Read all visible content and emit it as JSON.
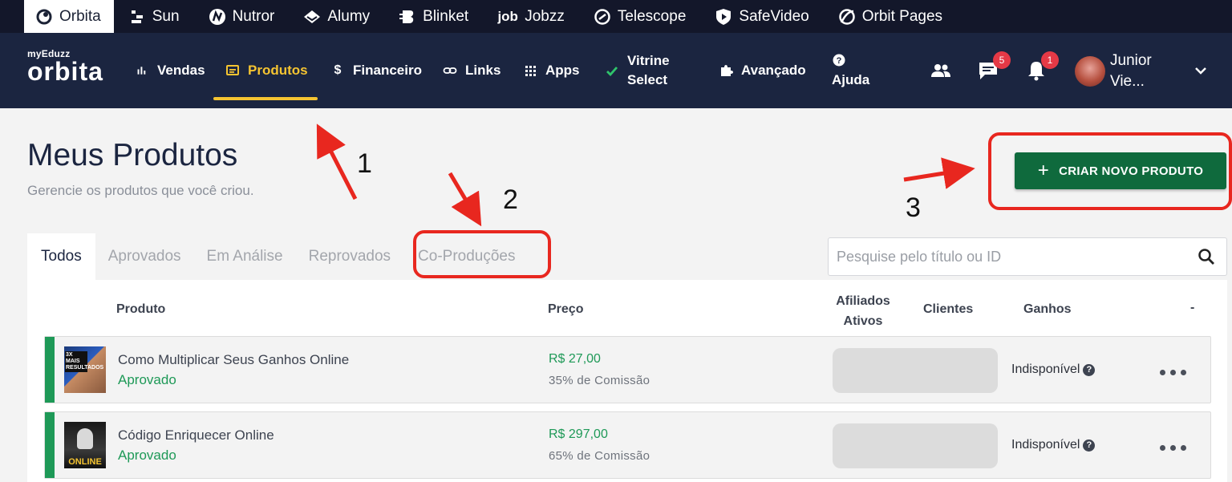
{
  "topbar": {
    "items": [
      {
        "label": "Orbita",
        "icon": "orbita-icon",
        "active": true
      },
      {
        "label": "Sun",
        "icon": "sun-icon"
      },
      {
        "label": "Nutror",
        "icon": "nutror-icon"
      },
      {
        "label": "Alumy",
        "icon": "alumy-icon"
      },
      {
        "label": "Blinket",
        "icon": "blinket-icon"
      },
      {
        "label": "Jobzz",
        "icon": "jobzz-icon"
      },
      {
        "label": "Telescope",
        "icon": "telescope-icon"
      },
      {
        "label": "SafeVideo",
        "icon": "safevideo-icon"
      },
      {
        "label": "Orbit Pages",
        "icon": "orbit-pages-icon"
      }
    ],
    "jobzz_logo_text": "job"
  },
  "nav": {
    "brand_small": "myEduzz",
    "brand_big": "orbita",
    "items": [
      {
        "label": "Vendas",
        "icon": "bar-chart-icon"
      },
      {
        "label": "Produtos",
        "icon": "product-icon",
        "active": true
      },
      {
        "label": "Financeiro",
        "icon": "dollar-icon"
      },
      {
        "label": "Links",
        "icon": "link-icon"
      },
      {
        "label": "Apps",
        "icon": "grid-icon"
      },
      {
        "label": "Vitrine Select",
        "label_line1": "Vitrine",
        "label_line2": "Select",
        "icon": "check-icon"
      },
      {
        "label": "Avançado",
        "icon": "puzzle-icon"
      },
      {
        "label": "Ajuda",
        "icon": "help-icon"
      }
    ],
    "chat_badge": "5",
    "notification_badge": "1",
    "user_name_line1": "Junior",
    "user_name_line2": "Vie..."
  },
  "page": {
    "title": "Meus Produtos",
    "subtitle": "Gerencie os produtos que você criou.",
    "create_button": "CRIAR NOVO PRODUTO",
    "create_button_plus": "+"
  },
  "tabs": [
    "Todos",
    "Aprovados",
    "Em Análise",
    "Reprovados",
    "Co-Produções"
  ],
  "search": {
    "placeholder": "Pesquise pelo título ou ID"
  },
  "table": {
    "headers": {
      "produto": "Produto",
      "preco": "Preço",
      "afiliados_line1": "Afiliados",
      "afiliados_line2": "Ativos",
      "clientes": "Clientes",
      "ganhos": "Ganhos",
      "actions": "-"
    },
    "rows": [
      {
        "name": "Como Multiplicar Seus Ganhos Online",
        "status": "Aprovado",
        "price": "R$ 27,00",
        "commission": "35% de Comissão",
        "ganhos": "Indisponível",
        "thumb_text": "3X MAIS RESULTADOS"
      },
      {
        "name": "Código Enriquecer Online",
        "status": "Aprovado",
        "price": "R$ 297,00",
        "commission": "65% de Comissão",
        "ganhos": "Indisponível",
        "thumb_text": "ONLINE"
      }
    ]
  },
  "annotations": {
    "one": "1",
    "two": "2",
    "three": "3",
    "color": "#e8271f"
  },
  "colors": {
    "topbar": "#13172a",
    "nav": "#1b2540",
    "accent": "#f5c431",
    "primary": "#0f6a3d",
    "success": "#1e9957"
  }
}
